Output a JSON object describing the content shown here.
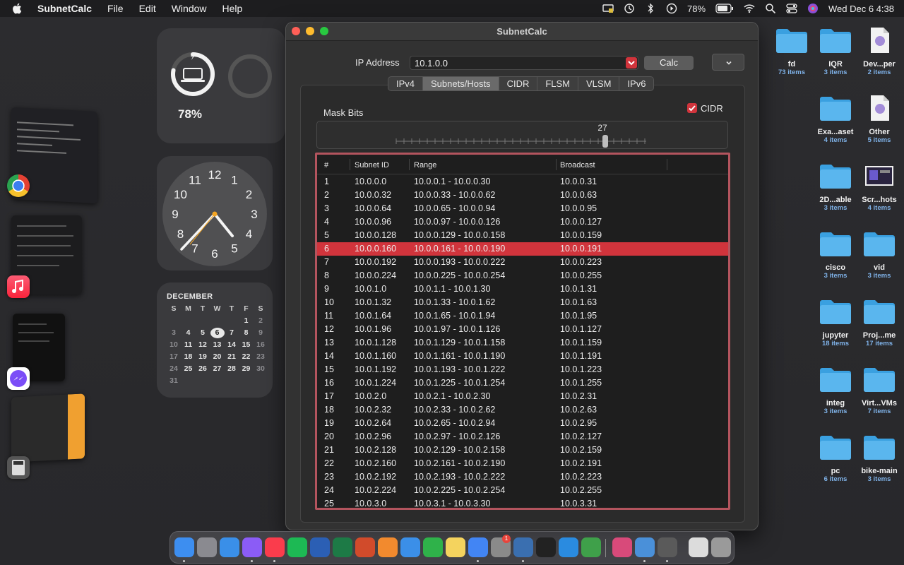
{
  "menubar": {
    "app_name": "SubnetCalc",
    "menus": [
      "File",
      "Edit",
      "Window",
      "Help"
    ],
    "battery": "78%",
    "datetime": "Wed Dec 6  4:38"
  },
  "widgets": {
    "battery_percent": "78%",
    "battery_level": 0.78,
    "clock_numbers": [
      "12",
      "1",
      "2",
      "3",
      "4",
      "5",
      "6",
      "7",
      "8",
      "9",
      "10",
      "11"
    ],
    "calendar": {
      "month": "DECEMBER",
      "weekdays": [
        "S",
        "M",
        "T",
        "W",
        "T",
        "F",
        "S"
      ],
      "today": "6"
    }
  },
  "window": {
    "title": "SubnetCalc",
    "ip_label": "IP Address",
    "ip_value": "10.1.0.0",
    "calc_button": "Calc",
    "tabs": [
      "IPv4",
      "Subnets/Hosts",
      "CIDR",
      "FLSM",
      "VLSM",
      "IPv6"
    ],
    "selected_tab": "Subnets/Hosts",
    "mask_label": "Mask Bits",
    "cidr_label": "CIDR",
    "cidr_checked": true,
    "mask_bits": "27",
    "table": {
      "headers": [
        "#",
        "Subnet ID",
        "Range",
        "Broadcast"
      ],
      "selected_row": "6",
      "rows": [
        [
          "1",
          "10.0.0.0",
          "10.0.0.1 - 10.0.0.30",
          "10.0.0.31"
        ],
        [
          "2",
          "10.0.0.32",
          "10.0.0.33 - 10.0.0.62",
          "10.0.0.63"
        ],
        [
          "3",
          "10.0.0.64",
          "10.0.0.65 - 10.0.0.94",
          "10.0.0.95"
        ],
        [
          "4",
          "10.0.0.96",
          "10.0.0.97 - 10.0.0.126",
          "10.0.0.127"
        ],
        [
          "5",
          "10.0.0.128",
          "10.0.0.129 - 10.0.0.158",
          "10.0.0.159"
        ],
        [
          "6",
          "10.0.0.160",
          "10.0.0.161 - 10.0.0.190",
          "10.0.0.191"
        ],
        [
          "7",
          "10.0.0.192",
          "10.0.0.193 - 10.0.0.222",
          "10.0.0.223"
        ],
        [
          "8",
          "10.0.0.224",
          "10.0.0.225 - 10.0.0.254",
          "10.0.0.255"
        ],
        [
          "9",
          "10.0.1.0",
          "10.0.1.1 - 10.0.1.30",
          "10.0.1.31"
        ],
        [
          "10",
          "10.0.1.32",
          "10.0.1.33 - 10.0.1.62",
          "10.0.1.63"
        ],
        [
          "11",
          "10.0.1.64",
          "10.0.1.65 - 10.0.1.94",
          "10.0.1.95"
        ],
        [
          "12",
          "10.0.1.96",
          "10.0.1.97 - 10.0.1.126",
          "10.0.1.127"
        ],
        [
          "13",
          "10.0.1.128",
          "10.0.1.129 - 10.0.1.158",
          "10.0.1.159"
        ],
        [
          "14",
          "10.0.1.160",
          "10.0.1.161 - 10.0.1.190",
          "10.0.1.191"
        ],
        [
          "15",
          "10.0.1.192",
          "10.0.1.193 - 10.0.1.222",
          "10.0.1.223"
        ],
        [
          "16",
          "10.0.1.224",
          "10.0.1.225 - 10.0.1.254",
          "10.0.1.255"
        ],
        [
          "17",
          "10.0.2.0",
          "10.0.2.1 - 10.0.2.30",
          "10.0.2.31"
        ],
        [
          "18",
          "10.0.2.32",
          "10.0.2.33 - 10.0.2.62",
          "10.0.2.63"
        ],
        [
          "19",
          "10.0.2.64",
          "10.0.2.65 - 10.0.2.94",
          "10.0.2.95"
        ],
        [
          "20",
          "10.0.2.96",
          "10.0.2.97 - 10.0.2.126",
          "10.0.2.127"
        ],
        [
          "21",
          "10.0.2.128",
          "10.0.2.129 - 10.0.2.158",
          "10.0.2.159"
        ],
        [
          "22",
          "10.0.2.160",
          "10.0.2.161 - 10.0.2.190",
          "10.0.2.191"
        ],
        [
          "23",
          "10.0.2.192",
          "10.0.2.193 - 10.0.2.222",
          "10.0.2.223"
        ],
        [
          "24",
          "10.0.2.224",
          "10.0.2.225 - 10.0.2.254",
          "10.0.2.255"
        ],
        [
          "25",
          "10.0.3.0",
          "10.0.3.1 - 10.0.3.30",
          "10.0.3.31"
        ]
      ]
    }
  },
  "desktop_icons": [
    {
      "name": "fd",
      "count": "73 items",
      "kind": "folder"
    },
    {
      "name": "IQR",
      "count": "3 items",
      "kind": "folder"
    },
    {
      "name": "Dev...per",
      "count": "2 items",
      "kind": "file"
    },
    {
      "name": "Exa...aset",
      "count": "4 items",
      "kind": "folder"
    },
    {
      "name": "Other",
      "count": "5 items",
      "kind": "file"
    },
    {
      "name": "2D...able",
      "count": "3 items",
      "kind": "folder"
    },
    {
      "name": "Scr...hots",
      "count": "4 items",
      "kind": "screenshot"
    },
    {
      "name": "cisco",
      "count": "3 items",
      "kind": "folder"
    },
    {
      "name": "vid",
      "count": "3 items",
      "kind": "folder"
    },
    {
      "name": "jupyter",
      "count": "18 items",
      "kind": "folder"
    },
    {
      "name": "Proj...me",
      "count": "17 items",
      "kind": "folder"
    },
    {
      "name": "integ",
      "count": "3 items",
      "kind": "folder"
    },
    {
      "name": "Virt...VMs",
      "count": "7 items",
      "kind": "folder"
    },
    {
      "name": "pc",
      "count": "6 items",
      "kind": "folder"
    },
    {
      "name": "bike-main",
      "count": "3 items",
      "kind": "folder"
    }
  ],
  "dock": {
    "apps": [
      "finder-icon",
      "launchpad-icon",
      "safari-icon",
      "messenger-icon",
      "music-icon",
      "spotify-icon",
      "word-icon",
      "excel-icon",
      "powerpoint-icon",
      "sublime-icon",
      "keynote-icon",
      "numbers-icon",
      "notes-icon",
      "chrome-icon",
      "settings-icon",
      "virtualbox-icon",
      "capcut-icon",
      "vscode-icon",
      "maps-icon",
      "preview-icon",
      "ipv-icon",
      "calculator-icon",
      "documents-icon",
      "trash-icon"
    ],
    "badge": "1"
  },
  "colors": {
    "accent": "#d1343c",
    "folder": "#5ab6ee",
    "window_bg": "#323232"
  }
}
